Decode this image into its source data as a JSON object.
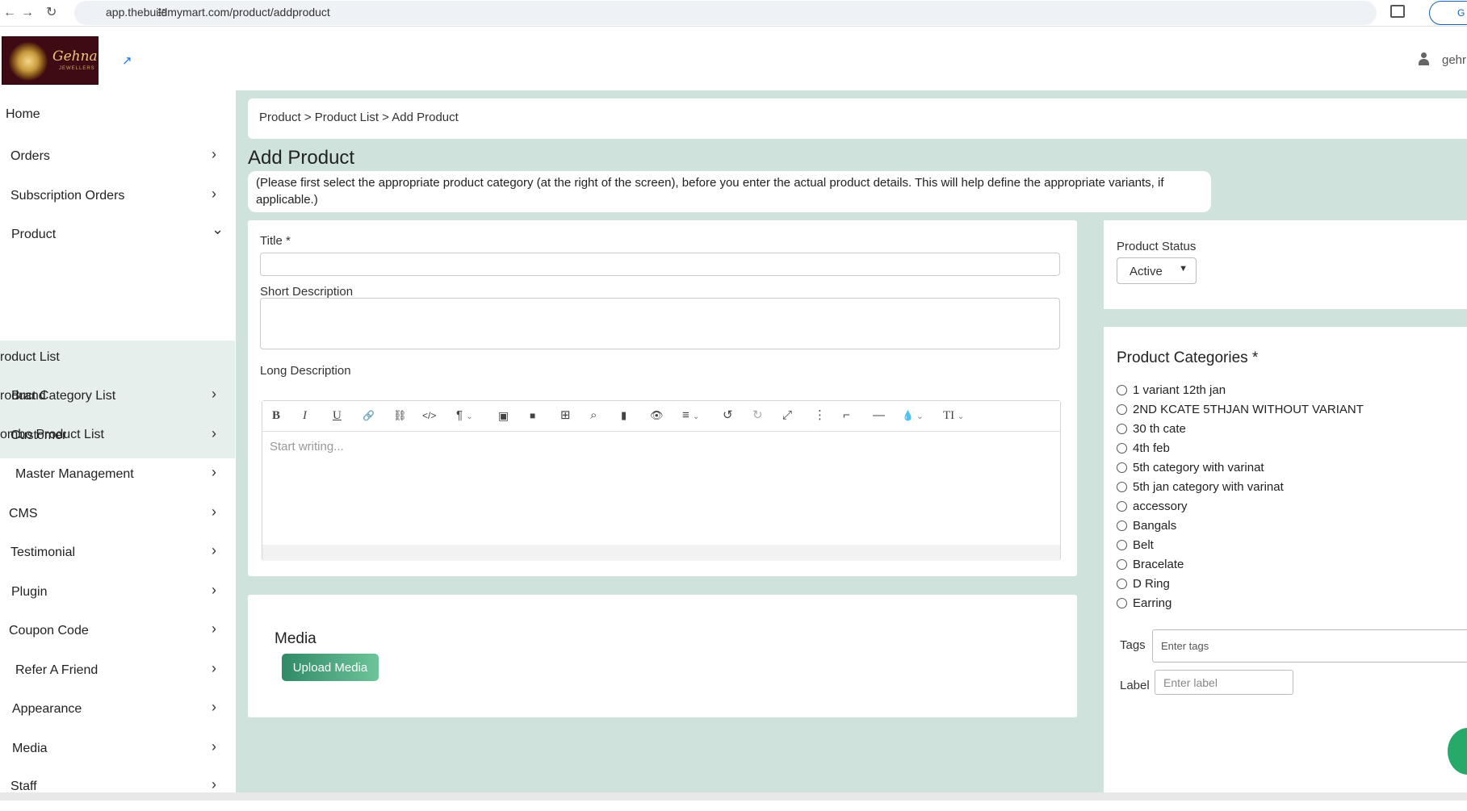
{
  "browser": {
    "url": "app.thebuildmymart.com/product/addproduct",
    "profile_initial": "G",
    "icons": {
      "back": "arrow-left-icon",
      "forward": "arrow-right-icon",
      "reload": "reload-icon",
      "site_info": "tune-icon"
    }
  },
  "header": {
    "logo_text": "Gehna",
    "logo_subtext": "JEWELLERS",
    "external_link_icon": "external-link-icon",
    "user_name": "gehr"
  },
  "sidebar": {
    "items": [
      {
        "label": "Home",
        "chevron": ""
      },
      {
        "label": "Orders",
        "chevron": "›"
      },
      {
        "label": "Subscription Orders",
        "chevron": "›"
      },
      {
        "label": "Product",
        "chevron": "⌄"
      },
      {
        "label": "Brand",
        "chevron": "›"
      },
      {
        "label": "Customer",
        "chevron": "›"
      },
      {
        "label": "Master Management",
        "chevron": "›"
      },
      {
        "label": "CMS",
        "chevron": "›"
      },
      {
        "label": "Testimonial",
        "chevron": "›"
      },
      {
        "label": "Plugin",
        "chevron": "›"
      },
      {
        "label": "Coupon Code",
        "chevron": "›"
      },
      {
        "label": "Refer A Friend",
        "chevron": "›"
      },
      {
        "label": "Appearance",
        "chevron": "›"
      },
      {
        "label": "Media",
        "chevron": "›"
      },
      {
        "label": "Staff",
        "chevron": "›"
      }
    ],
    "submenu": [
      "roduct List",
      "roduct Category List",
      "ombo Product List"
    ]
  },
  "breadcrumb": "Product > Product List > Add Product",
  "page_title": "Add Product",
  "notice": "(Please first select the appropriate product category (at the right of the screen), before you enter the actual product details. This will help define the appropriate variants, if applicable.)",
  "form": {
    "title_label": "Title *",
    "title_value": "",
    "short_desc_label": "Short Description",
    "short_desc_value": "",
    "long_desc_label": "Long Description",
    "editor_placeholder": "Start writing...",
    "toolbar": [
      "B",
      "I",
      "U",
      "🔗",
      "⛓",
      "</>",
      "¶",
      "▣",
      "■",
      "⊞",
      "⌕",
      "▮",
      "👁",
      "≡",
      "↺",
      "↻",
      "⤢",
      "⋮",
      "⌐",
      "—",
      "💧",
      "TI"
    ]
  },
  "media": {
    "title": "Media",
    "upload_label": "Upload Media"
  },
  "status": {
    "label": "Product Status",
    "value": "Active"
  },
  "categories": {
    "title": "Product Categories *",
    "items": [
      "1 variant 12th jan",
      "2ND KCATE 5THJAN WITHOUT VARIANT",
      "30 th cate",
      "4th feb",
      "5th category with varinat",
      "5th jan category with varinat",
      "accessory",
      "Bangals",
      "Belt",
      "Bracelate",
      "D Ring",
      "Earring"
    ]
  },
  "tags": {
    "label": "Tags",
    "placeholder": "Enter tags"
  },
  "label_field": {
    "label": "Label",
    "placeholder": "Enter label"
  },
  "colors": {
    "accent": "#2f8a66",
    "main_bg": "#cfe3dc",
    "logo_bg": "#3e0a14"
  }
}
